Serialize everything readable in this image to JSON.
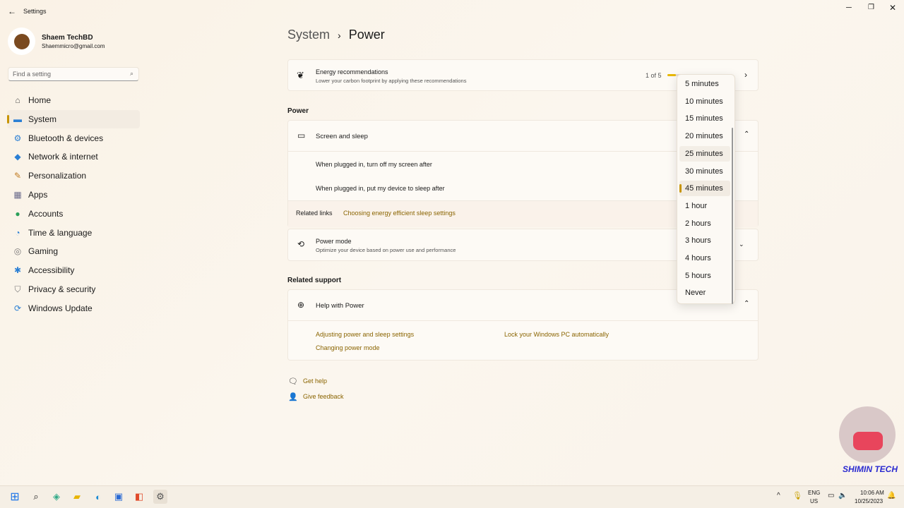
{
  "window": {
    "title": "Settings"
  },
  "user": {
    "name": "Shaem TechBD",
    "email": "Shaemmicro@gmail.com"
  },
  "search": {
    "placeholder": "Find a setting"
  },
  "sidebar": {
    "items": [
      {
        "label": "Home",
        "icon": "home-icon",
        "glyph": "⌂",
        "color": "#555"
      },
      {
        "label": "System",
        "icon": "system-icon",
        "glyph": "▬",
        "color": "#2a7fd4"
      },
      {
        "label": "Bluetooth & devices",
        "icon": "bluetooth-icon",
        "glyph": "⚙",
        "color": "#2a7fd4"
      },
      {
        "label": "Network & internet",
        "icon": "wifi-icon",
        "glyph": "◆",
        "color": "#2a7fd4"
      },
      {
        "label": "Personalization",
        "icon": "brush-icon",
        "glyph": "✎",
        "color": "#c07a20"
      },
      {
        "label": "Apps",
        "icon": "apps-icon",
        "glyph": "▦",
        "color": "#6a6a8a"
      },
      {
        "label": "Accounts",
        "icon": "accounts-icon",
        "glyph": "●",
        "color": "#2aa05a"
      },
      {
        "label": "Time & language",
        "icon": "globe-clock-icon",
        "glyph": "◔",
        "color": "#2a7fd4"
      },
      {
        "label": "Gaming",
        "icon": "gaming-icon",
        "glyph": "◎",
        "color": "#777"
      },
      {
        "label": "Accessibility",
        "icon": "accessibility-icon",
        "glyph": "✱",
        "color": "#2a7fd4"
      },
      {
        "label": "Privacy & security",
        "icon": "shield-icon",
        "glyph": "⛉",
        "color": "#777"
      },
      {
        "label": "Windows Update",
        "icon": "update-icon",
        "glyph": "⟳",
        "color": "#2a7fd4"
      }
    ],
    "active": 1
  },
  "breadcrumb": {
    "parent": "System",
    "sep": "›",
    "current": "Power"
  },
  "energy": {
    "title": "Energy recommendations",
    "subtitle": "Lower your carbon footprint by applying these recommendations",
    "progress_text": "1 of 5",
    "progress": 0.2
  },
  "power_section": "Power",
  "screen_sleep": {
    "title": "Screen and sleep",
    "rows": [
      "When plugged in, turn off my screen after",
      "When plugged in, put my device to sleep after"
    ],
    "related_label": "Related links",
    "related_link": "Choosing energy efficient sleep settings"
  },
  "power_mode": {
    "title": "Power mode",
    "subtitle": "Optimize your device based on power use and performance"
  },
  "related_support": "Related support",
  "help": {
    "title": "Help with Power",
    "links": [
      "Adjusting power and sleep settings",
      "Lock your Windows PC automatically",
      "Changing power mode"
    ]
  },
  "footer": {
    "get_help": "Get help",
    "feedback": "Give feedback"
  },
  "dropdown": {
    "options": [
      "5 minutes",
      "10 minutes",
      "15 minutes",
      "20 minutes",
      "25 minutes",
      "30 minutes",
      "45 minutes",
      "1 hour",
      "2 hours",
      "3 hours",
      "4 hours",
      "5 hours",
      "Never"
    ],
    "selected": "45 minutes",
    "hovered": "25 minutes"
  },
  "watermark": {
    "text": "SHIMIN TECH"
  },
  "tray": {
    "lang1": "ENG",
    "lang2": "US",
    "time": "10:06 AM",
    "date": "10/25/2023"
  },
  "accent": "#c79400"
}
